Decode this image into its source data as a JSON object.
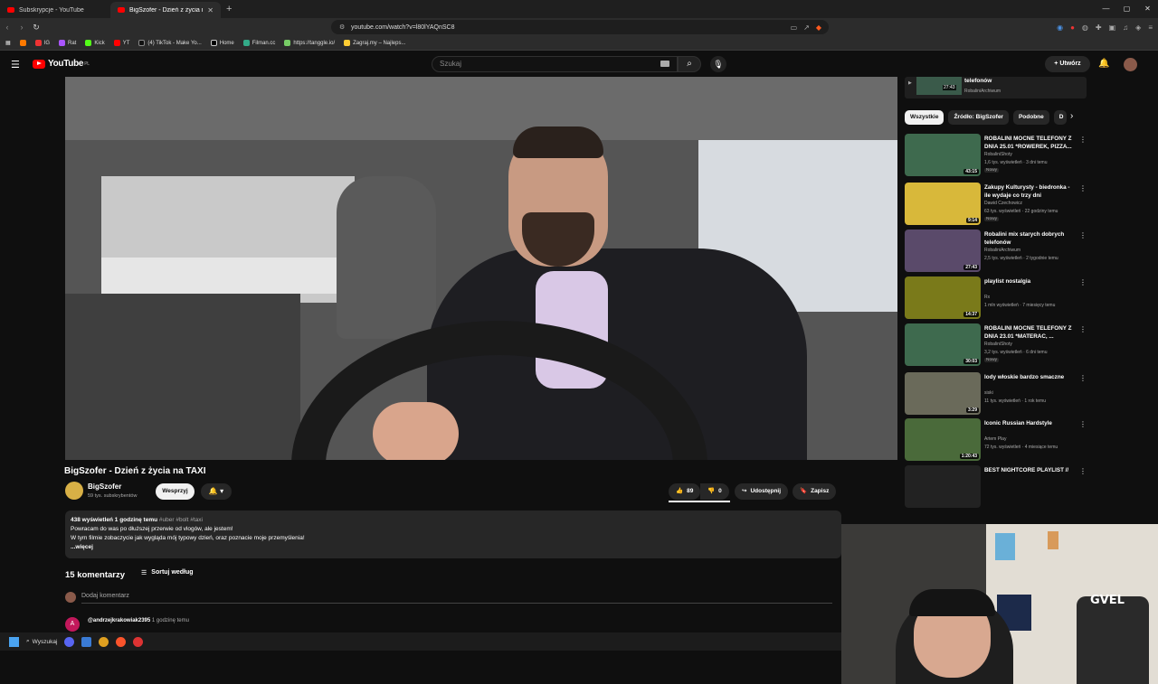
{
  "browser": {
    "tabs": [
      {
        "title": "Subskrypcje - YouTube",
        "active": false
      },
      {
        "title": "BigSzofer - Dzień z życia na TAXI",
        "active": true
      }
    ],
    "url": "youtube.com/watch?v=l80lYAQnSC8",
    "bookmarks": [
      "IG",
      "Rat",
      "Kick",
      "YT",
      "(4) TikTok - Make Yo...",
      "Home",
      "Filman.cc",
      "https://tanggle.io/",
      "Zagraj.my – Najleps..."
    ]
  },
  "youtube": {
    "logo_text": "YouTube",
    "logo_region": "PL",
    "search_placeholder": "Szukaj",
    "create_label": "Utwórz",
    "video": {
      "title": "BigSzofer - Dzień z życia na TAXI",
      "channel": "BigSzofer",
      "subscribers": "59 tys. subskrybentów",
      "support_label": "Wesprzyj",
      "likes": "89",
      "dislikes": "0",
      "share_label": "Udostępnij",
      "save_label": "Zapisz",
      "description_stats": "438 wyświetleń  1 godzinę temu",
      "description_tags": "#uber #bolt #taxi",
      "description_line1": "Powracam do was po dłuższej przerwie od vlogów, ale jestem!",
      "description_line2": "W tym filmie zobaczycie jak wygląda mój typowy dzień, oraz poznacie moje przemyślenia!",
      "more_label": "...więcej"
    },
    "comments": {
      "count_label": "15 komentarzy",
      "sort_label": "Sortuj według",
      "add_placeholder": "Dodaj komentarz",
      "first_author": "@andrzejkrakowiak2395",
      "first_time": "1 godzinę temu",
      "first_initial": "A"
    },
    "sidebar": {
      "top_item": {
        "title": "telefonów",
        "channel": "RobaliniArchiwum",
        "duration": "27:43"
      },
      "chips": [
        "Wszystkie",
        "Źródło: BigSzofer",
        "Podobne",
        "D"
      ],
      "items": [
        {
          "title": "ROBALINI MOCNE TELEFONY Z DNIA 25.01 *ROWEREK, PIZZA...",
          "channel": "RobaliniShoty",
          "meta": "1,6 tys. wyświetleń · 3 dni temu",
          "badge": "Nowy",
          "duration": "43:15",
          "thumb_color": "#3e6a4e"
        },
        {
          "title": "Zakupy Kulturysty - biedronka - ile wydaje co trzy dni",
          "channel": "Dawid Czechowicz",
          "meta": "63 tys. wyświetleń · 22 godziny temu",
          "badge": "Nowy",
          "duration": "9:14",
          "thumb_color": "#d8b83a"
        },
        {
          "title": "Robalini mix starych dobrych telefonów",
          "channel": "RobaliniArchiwum",
          "meta": "2,5 tys. wyświetleń · 2 tygodnie temu",
          "badge": "",
          "duration": "27:43",
          "thumb_color": "#5a4a6a"
        },
        {
          "title": "playlist nostalgia",
          "channel": "Rx",
          "meta": "1 mln wyświetleń · 7 miesięcy temu",
          "badge": "",
          "duration": "14:37",
          "thumb_color": "#7a7a1a"
        },
        {
          "title": "ROBALINI MOCNE TELEFONY Z DNIA 23.01 *MATERAC, ...",
          "channel": "RobaliniShoty",
          "meta": "3,2 tys. wyświetleń · 6 dni temu",
          "badge": "Nowy",
          "duration": "30:03",
          "thumb_color": "#3e6a4e"
        },
        {
          "title": "lody włoskie bardzo smaczne",
          "channel": "siski",
          "meta": "11 tys. wyświetleń · 1 rok temu",
          "badge": "",
          "duration": "3:29",
          "thumb_color": "#6a6a5a"
        },
        {
          "title": "Iconic Russian Hardstyle",
          "channel": "Artem Play",
          "meta": "72 tys. wyświetleń · 4 miesiące temu",
          "badge": "",
          "duration": "1:20:43",
          "thumb_color": "#4a6a3a"
        },
        {
          "title": "BEST NIGHTCORE PLAYLIST //",
          "channel": "",
          "meta": "",
          "badge": "",
          "duration": "",
          "thumb_color": "#222"
        }
      ]
    }
  },
  "webcam_overlay": "GVEL",
  "taskbar": {
    "search_label": "Wyszukaj"
  }
}
